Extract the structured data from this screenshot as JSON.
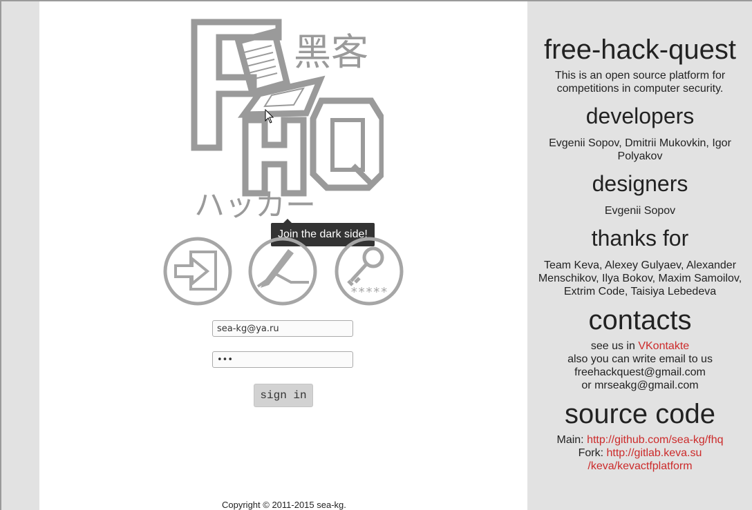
{
  "logo": {
    "glyphs_top": "黑客",
    "glyphs_bottom": "ハッカー",
    "letters": "FHQ"
  },
  "tooltip": "Join the dark side!",
  "actions": [
    {
      "name": "login-icon"
    },
    {
      "name": "register-icon"
    },
    {
      "name": "restore-password-icon",
      "mask": "*****"
    }
  ],
  "login": {
    "email_value": "sea-kg@ya.ru",
    "password_value": "•••",
    "signin_label": "sign in"
  },
  "copyright": "Copyright © 2011-2015 sea-kg.",
  "sidebar": {
    "title": "free-hack-quest",
    "intro": "This is an open source platform for competitions in computer security.",
    "developers_heading": "developers",
    "developers": "Evgenii Sopov, Dmitrii Mukovkin, Igor Polyakov",
    "designers_heading": "designers",
    "designers": "Evgenii Sopov",
    "thanks_heading": "thanks for",
    "thanks": "Team Keva, Alexey Gulyaev, Alexander Menschikov, Ilya Bokov, Maxim Samoilov, Extrim Code, Taisiya Lebedeva",
    "contacts_heading": "contacts",
    "contacts_see": "see us in",
    "contacts_vk": "VKontakte",
    "contacts_email_line": "also you can write email to us",
    "contacts_email1": "freehackquest@gmail.com",
    "contacts_or": "or",
    "contacts_email2": "mrseakg@gmail.com",
    "source_heading": "source code",
    "main_label": "Main:",
    "main_link": "http://github.com/sea-kg/fhq",
    "fork_label": "Fork:",
    "fork_link_1": "http://gitlab.keva.su",
    "fork_link_2": "/keva/kevactfplatform"
  },
  "colors": {
    "background": "#e2e2e2",
    "panel": "#ffffff",
    "link": "#cc2a2a",
    "logo_gray": "#9a9a9a"
  }
}
